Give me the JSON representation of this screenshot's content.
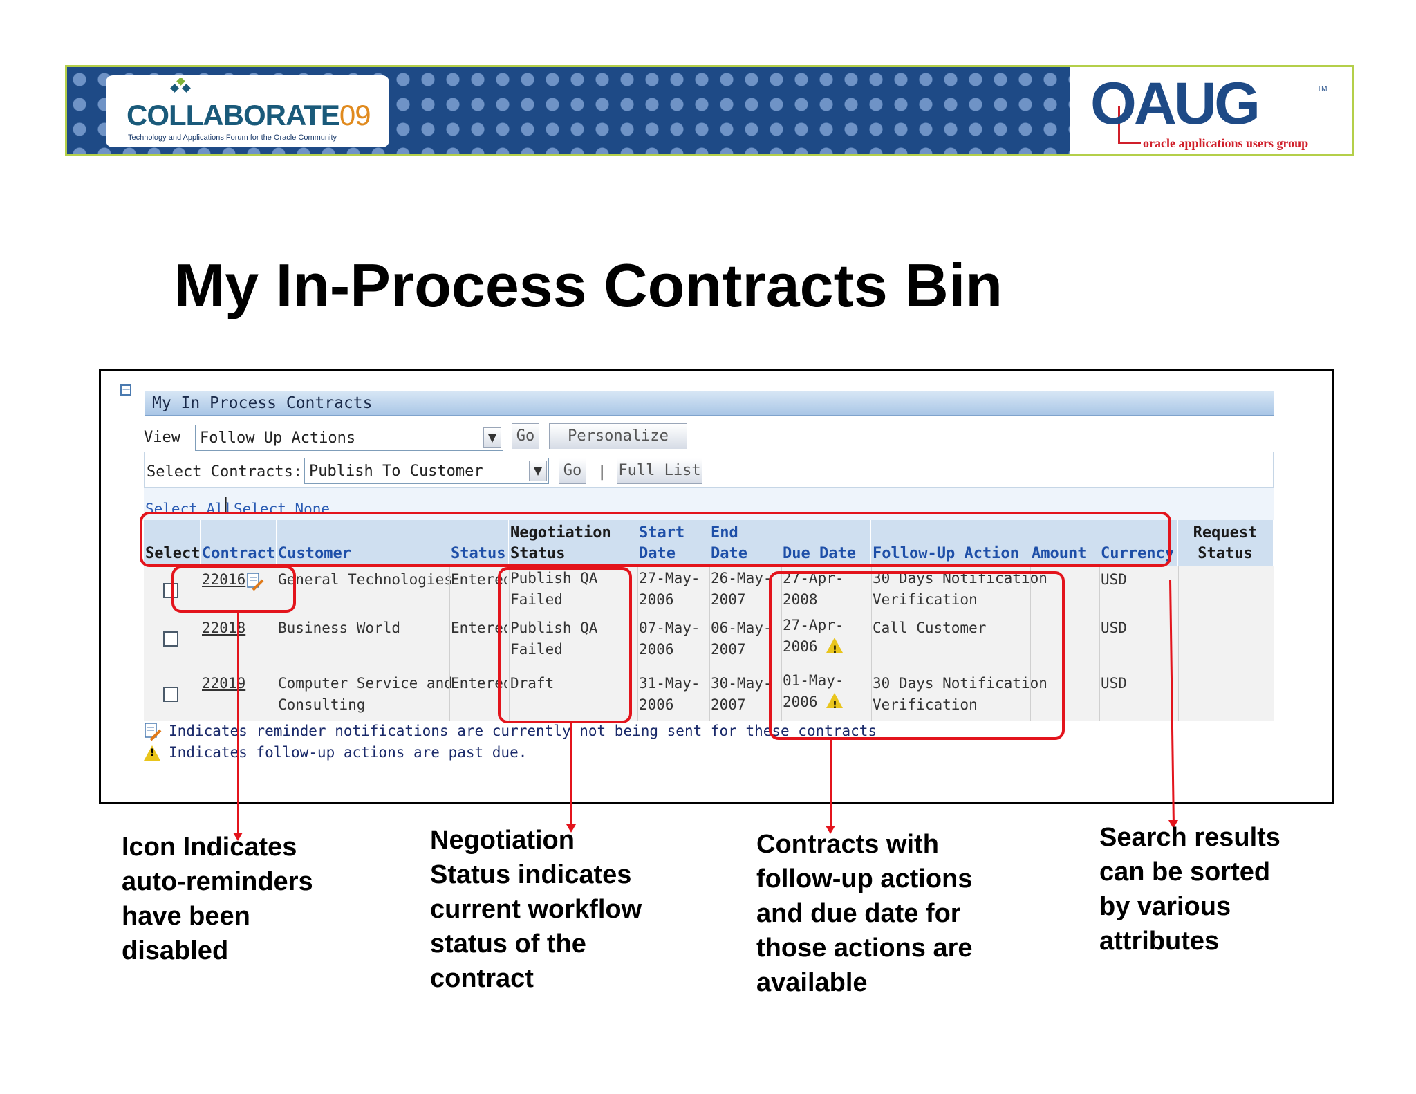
{
  "banner": {
    "collab_main": "COLLABORATE",
    "collab_year": "09",
    "collab_tagline": "Technology and Applications Forum for the Oracle Community",
    "oaug_word": "OAUG",
    "oaug_tm": "TM",
    "oaug_sub": "oracle applications users group",
    "colors": {
      "pattern": "#1e4a86",
      "border": "#b4cf4a",
      "accent": "#d01f2a"
    }
  },
  "title": "My In-Process Contracts Bin",
  "region": {
    "title": "My In Process Contracts",
    "collapse_icon": "minus-box-icon"
  },
  "view": {
    "label": "View",
    "selected": "Follow Up Actions",
    "go_label": "Go",
    "personalize_label": "Personalize"
  },
  "select_contracts": {
    "label": "Select Contracts:",
    "selected": "Publish To Customer",
    "go_label": "Go",
    "separator": "|",
    "full_list_label": "Full List"
  },
  "select_links": {
    "select_all": "Select All",
    "separator": "|",
    "select_none": "Select None"
  },
  "table": {
    "headers": {
      "select": "Select",
      "contract": "Contract",
      "customer": "Customer",
      "status": "Status",
      "negotiation_status": "Negotiation Status",
      "start_date": "Start Date",
      "end_date": "End Date",
      "due_date": "Due Date",
      "follow_up_action": "Follow-Up Action",
      "amount": "Amount",
      "currency": "Currency",
      "request_status": "Request Status"
    },
    "rows": [
      {
        "contract": "22016",
        "customer": "General Technologies",
        "customer2": "",
        "status": "Entered",
        "neg1": "Publish QA",
        "neg2": "Failed",
        "start1": "27-May-",
        "start2": "2006",
        "end1": "26-May-",
        "end2": "2007",
        "due1": "27-Apr-",
        "due2": "2008",
        "action1": "30 Days Notification",
        "action2": "Verification",
        "amount": "",
        "currency": "USD",
        "request_status": "",
        "reminder_icon": true,
        "past_due": false
      },
      {
        "contract": "22018",
        "customer": "Business World",
        "customer2": "",
        "status": "Entered",
        "neg1": "Publish QA",
        "neg2": "Failed",
        "start1": "07-May-",
        "start2": "2006",
        "end1": "06-May-",
        "end2": "2007",
        "due1": "27-Apr-",
        "due2": "2006",
        "action1": "Call Customer",
        "action2": "",
        "amount": "",
        "currency": "USD",
        "request_status": "",
        "reminder_icon": false,
        "past_due": true
      },
      {
        "contract": "22019",
        "customer": "Computer Service and",
        "customer2": "Consulting",
        "status": "Entered",
        "neg1": "Draft",
        "neg2": "",
        "start1": "31-May-",
        "start2": "2006",
        "end1": "30-May-",
        "end2": "2007",
        "due1": "01-May-",
        "due2": "2006",
        "action1": "30 Days Notification",
        "action2": "Verification",
        "amount": "",
        "currency": "USD",
        "request_status": "",
        "reminder_icon": false,
        "past_due": true
      }
    ]
  },
  "legend": {
    "reminder": "Indicates reminder notifications are currently not being sent for these contracts",
    "past_due": "Indicates follow-up actions are past due."
  },
  "callouts": {
    "c1": "Icon Indicates\nauto-reminders\nhave been\ndisabled",
    "c2": "Negotiation\nStatus indicates\ncurrent workflow\nstatus of the\ncontract",
    "c3": "Contracts with\nfollow-up actions\nand due date for\nthose actions are\navailable",
    "c4": "Search results\ncan be sorted\nby various\nattributes"
  }
}
